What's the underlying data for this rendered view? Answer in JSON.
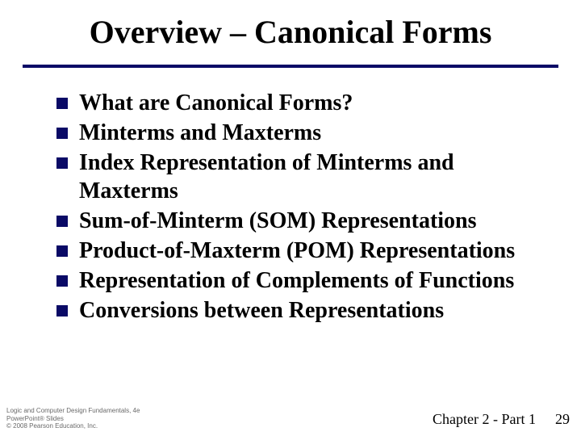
{
  "title": "Overview – Canonical Forms",
  "bullets": [
    "What are Canonical Forms?",
    "Minterms and Maxterms",
    "Index Representation of Minterms and Maxterms",
    "Sum-of-Minterm (SOM) Representations",
    "Product-of-Maxterm (POM) Representations",
    "Representation of Complements of Functions",
    "Conversions between Representations"
  ],
  "footer": {
    "line1": "Logic and Computer Design Fundamentals, 4e",
    "line2": "PowerPoint® Slides",
    "line3": "© 2008 Pearson Education, Inc.",
    "chapter": "Chapter 2 - Part 1",
    "page": "29"
  }
}
